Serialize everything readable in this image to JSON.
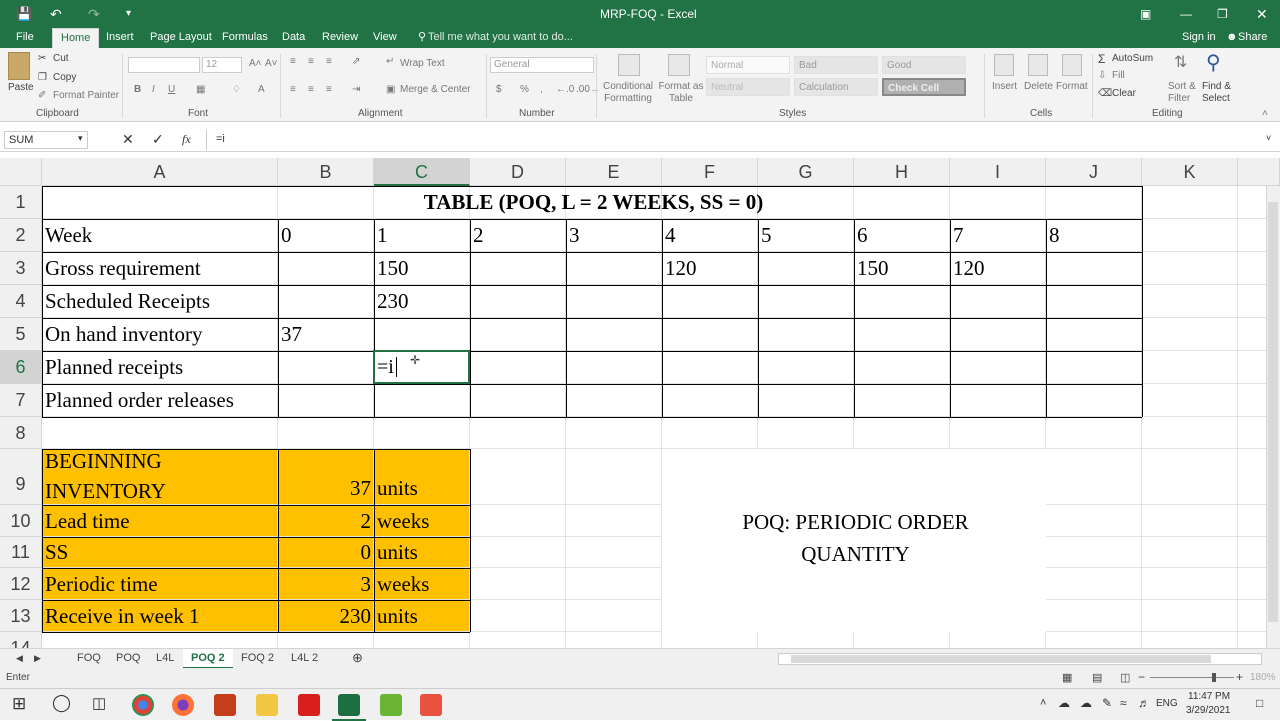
{
  "window": {
    "title": "MRP-FOQ - Excel"
  },
  "ribbon": {
    "tabs": [
      "File",
      "Home",
      "Insert",
      "Page Layout",
      "Formulas",
      "Data",
      "Review",
      "View"
    ],
    "active_tab": "Home",
    "tell_me": "Tell me what you want to do...",
    "sign_in": "Sign in",
    "share": "Share",
    "clipboard": {
      "paste": "Paste",
      "cut": "Cut",
      "copy": "Copy",
      "format_painter": "Format Painter",
      "label": "Clipboard"
    },
    "font": {
      "size": "12",
      "label": "Font"
    },
    "alignment": {
      "wrap": "Wrap Text",
      "merge": "Merge & Center",
      "label": "Alignment"
    },
    "number": {
      "format": "General",
      "label": "Number"
    },
    "styles": {
      "conditional": "Conditional Formatting",
      "format_table": "Format as Table",
      "normal": "Normal",
      "bad": "Bad",
      "good": "Good",
      "neutral": "Neutral",
      "calculation": "Calculation",
      "check_cell": "Check Cell",
      "label": "Styles"
    },
    "cells": {
      "insert": "Insert",
      "delete": "Delete",
      "format": "Format",
      "label": "Cells"
    },
    "editing": {
      "autosum": "AutoSum",
      "fill": "Fill",
      "clear": "Clear",
      "sort": "Sort & Filter",
      "find": "Find & Select",
      "label": "Editing"
    }
  },
  "formula_bar": {
    "name_box": "SUM",
    "fx": "fx",
    "formula": "=i"
  },
  "columns": [
    "A",
    "B",
    "C",
    "D",
    "E",
    "F",
    "G",
    "H",
    "I",
    "J",
    "K"
  ],
  "rows": [
    "1",
    "2",
    "3",
    "4",
    "5",
    "6",
    "7",
    "8",
    "9",
    "10",
    "11",
    "12",
    "13",
    "14"
  ],
  "table": {
    "title": "TABLE (POQ, L = 2 WEEKS, SS = 0)",
    "week_label": "Week",
    "weeks": [
      "0",
      "1",
      "2",
      "3",
      "4",
      "5",
      "6",
      "7",
      "8"
    ],
    "gross_label": "Gross requirement",
    "gross": {
      "C": "150",
      "F": "120",
      "H": "150",
      "I": "120"
    },
    "sched_label": "Scheduled Receipts",
    "sched": {
      "C": "230"
    },
    "onhand_label": "On hand inventory",
    "onhand": {
      "B": "37"
    },
    "planned_label": "Planned receipts",
    "editing_value": "=i",
    "releases_label": "Planned order releases"
  },
  "params": [
    {
      "label_1": "BEGINNING",
      "label_2": "INVENTORY",
      "value": "37",
      "unit": "units"
    },
    {
      "label": "Lead time",
      "value": "2",
      "unit": "weeks"
    },
    {
      "label": "SS",
      "value": "0",
      "unit": "units"
    },
    {
      "label": "Periodic time",
      "value": "3",
      "unit": "weeks"
    },
    {
      "label": "Receive in week 1",
      "value": "230",
      "unit": "units"
    }
  ],
  "note": {
    "line1": "POQ: PERIODIC ORDER",
    "line2": "QUANTITY"
  },
  "sheet_tabs": [
    "FOQ",
    "POQ",
    "L4L",
    "POQ 2",
    "FOQ 2",
    "L4L 2"
  ],
  "active_sheet": "POQ 2",
  "status": {
    "mode": "Enter",
    "zoom": "180%"
  },
  "taskbar": {
    "lang": "ENG",
    "time": "11:47 PM",
    "date": "3/29/2021"
  }
}
